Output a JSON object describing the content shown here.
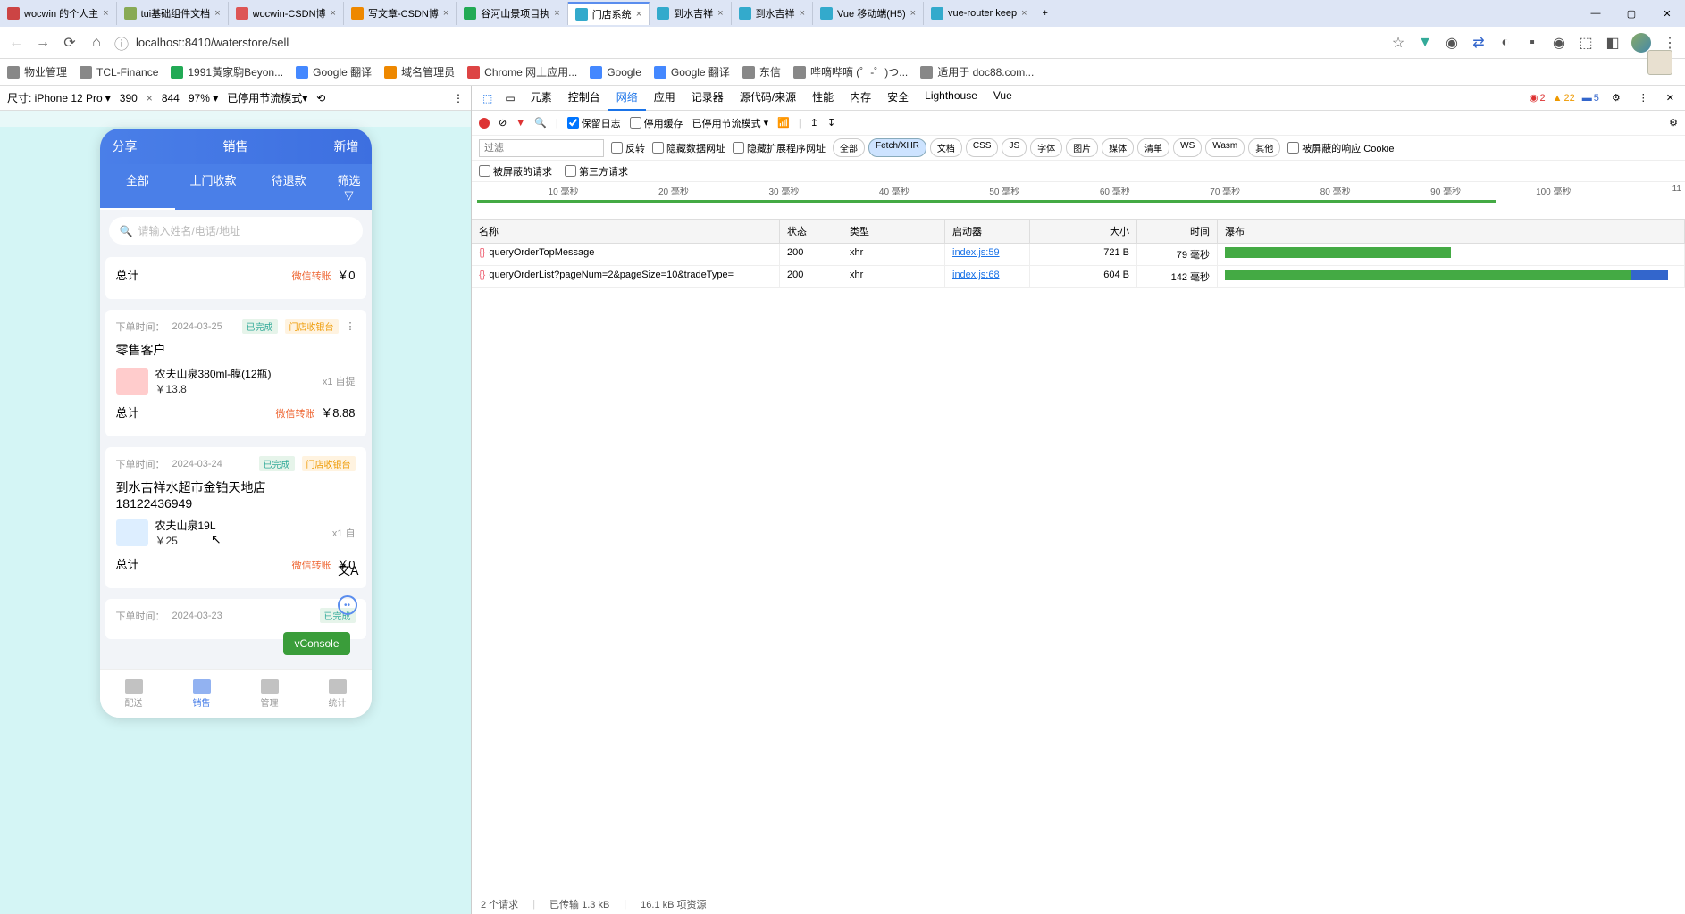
{
  "browser": {
    "tabs": [
      {
        "title": "wocwin 的个人主",
        "favicon": "#c44"
      },
      {
        "title": "tui基础组件文档",
        "favicon": "#8a5"
      },
      {
        "title": "wocwin-CSDN博",
        "favicon": "#d55"
      },
      {
        "title": "写文章-CSDN博",
        "favicon": "#e80"
      },
      {
        "title": "谷河山景项目执",
        "favicon": "#2a5"
      },
      {
        "title": "门店系统",
        "favicon": "#3ac",
        "active": true
      },
      {
        "title": "到水吉祥",
        "favicon": "#3ac"
      },
      {
        "title": "到水吉祥",
        "favicon": "#3ac"
      },
      {
        "title": "Vue 移动端(H5)",
        "favicon": "#3ac"
      },
      {
        "title": "vue-router keep",
        "favicon": "#3ac"
      }
    ],
    "url": "localhost:8410/waterstore/sell",
    "bookmarks": [
      {
        "label": "物业管理",
        "color": "#888"
      },
      {
        "label": "TCL-Finance",
        "color": "#888"
      },
      {
        "label": "1991黃家駒Beyon...",
        "color": "#2a5"
      },
      {
        "label": "Google 翻译",
        "color": "#48f"
      },
      {
        "label": "域名管理员",
        "color": "#e80"
      },
      {
        "label": "Chrome 网上应用...",
        "color": "#d44"
      },
      {
        "label": "Google",
        "color": "#48f"
      },
      {
        "label": "Google 翻译",
        "color": "#48f"
      },
      {
        "label": "东信",
        "color": "#888"
      },
      {
        "label": "哔嘀哔嘀 (゜-゜)つ...",
        "color": "#888"
      },
      {
        "label": "适用于 doc88.com...",
        "color": "#888"
      }
    ]
  },
  "device_toolbar": {
    "device": "尺寸: iPhone 12 Pro",
    "width": "390",
    "height": "844",
    "zoom": "97%",
    "throttle": "已停用节流模式"
  },
  "phone": {
    "header": {
      "left": "分享",
      "center": "销售",
      "right": "新增"
    },
    "tabs": [
      "全部",
      "上门收款",
      "待退款"
    ],
    "filter_tab": "筛选",
    "search_placeholder": "请输入姓名/电话/地址",
    "orders": [
      {
        "total_label": "总计",
        "pay_method": "微信转账",
        "total": "￥0",
        "time_label": "下单时间：",
        "time": "2024-03-25",
        "status": "已完成",
        "source": "门店收银台",
        "customer": "零售客户",
        "items": [
          {
            "name": "农夫山泉380ml-膜(12瓶)",
            "price": "￥13.8",
            "qty": "x1 自提"
          }
        ],
        "subtotal_label": "总计",
        "sub_pay": "微信转账",
        "subtotal": "￥8.88"
      },
      {
        "time_label": "下单时间：",
        "time": "2024-03-24",
        "status": "已完成",
        "source": "门店收银台",
        "customer": "到水吉祥水超市金铂天地店",
        "phone": "18122436949",
        "items": [
          {
            "name": "农夫山泉19L",
            "price": "￥25",
            "qty": "x1 自"
          }
        ],
        "subtotal_label": "总计",
        "sub_pay": "微信转账",
        "subtotal": "￥0"
      },
      {
        "time_label": "下单时间：",
        "time": "2024-03-23",
        "status": "已完成",
        "source": ""
      }
    ],
    "vconsole": "vConsole",
    "bottom_nav": [
      {
        "label": "配送"
      },
      {
        "label": "销售",
        "active": true
      },
      {
        "label": "管理"
      },
      {
        "label": "统计"
      }
    ]
  },
  "devtools": {
    "tabs": [
      "元素",
      "控制台",
      "网络",
      "应用",
      "记录器",
      "源代码/来源",
      "性能",
      "内存",
      "安全",
      "Lighthouse",
      "Vue"
    ],
    "active_tab": "网络",
    "badges": {
      "errors": "2",
      "warnings": "22",
      "info": "5"
    },
    "filter_bar": {
      "preserve_log": "保留日志",
      "disable_cache": "停用缓存",
      "throttle": "已停用节流模式"
    },
    "filter_placeholder": "过滤",
    "filter_checks": {
      "invert": "反转",
      "hide_data": "隐藏数据网址",
      "hide_ext": "隐藏扩展程序网址"
    },
    "type_filters": [
      "全部",
      "Fetch/XHR",
      "文档",
      "CSS",
      "JS",
      "字体",
      "图片",
      "媒体",
      "清单",
      "WS",
      "Wasm",
      "其他"
    ],
    "type_active": "Fetch/XHR",
    "blocked_cookie": "被屏蔽的响应 Cookie",
    "row3": {
      "blocked_req": "被屏蔽的请求",
      "third_party": "第三方请求"
    },
    "timeline_labels": [
      "10 毫秒",
      "20 毫秒",
      "30 毫秒",
      "40 毫秒",
      "50 毫秒",
      "60 毫秒",
      "70 毫秒",
      "80 毫秒",
      "90 毫秒",
      "100 毫秒",
      "11"
    ],
    "columns": {
      "name": "名称",
      "status": "状态",
      "type": "类型",
      "initiator": "启动器",
      "size": "大小",
      "time": "时间",
      "waterfall": "瀑布"
    },
    "requests": [
      {
        "name": "queryOrderTopMessage",
        "status": "200",
        "type": "xhr",
        "initiator": "index.js:59",
        "size": "721 B",
        "time": "79 毫秒",
        "wf": {
          "start": 0,
          "len": 50,
          "color": "#4a4"
        }
      },
      {
        "name": "queryOrderList?pageNum=2&pageSize=10&tradeType=",
        "status": "200",
        "type": "xhr",
        "initiator": "index.js:68",
        "size": "604 B",
        "time": "142 毫秒",
        "wf": {
          "start": 0,
          "len": 90,
          "color": "#4a4",
          "tail": "#36c"
        }
      }
    ],
    "status_bar": {
      "requests": "2 个请求",
      "transferred": "已传输 1.3 kB",
      "resources": "16.1 kB 项资源"
    }
  }
}
